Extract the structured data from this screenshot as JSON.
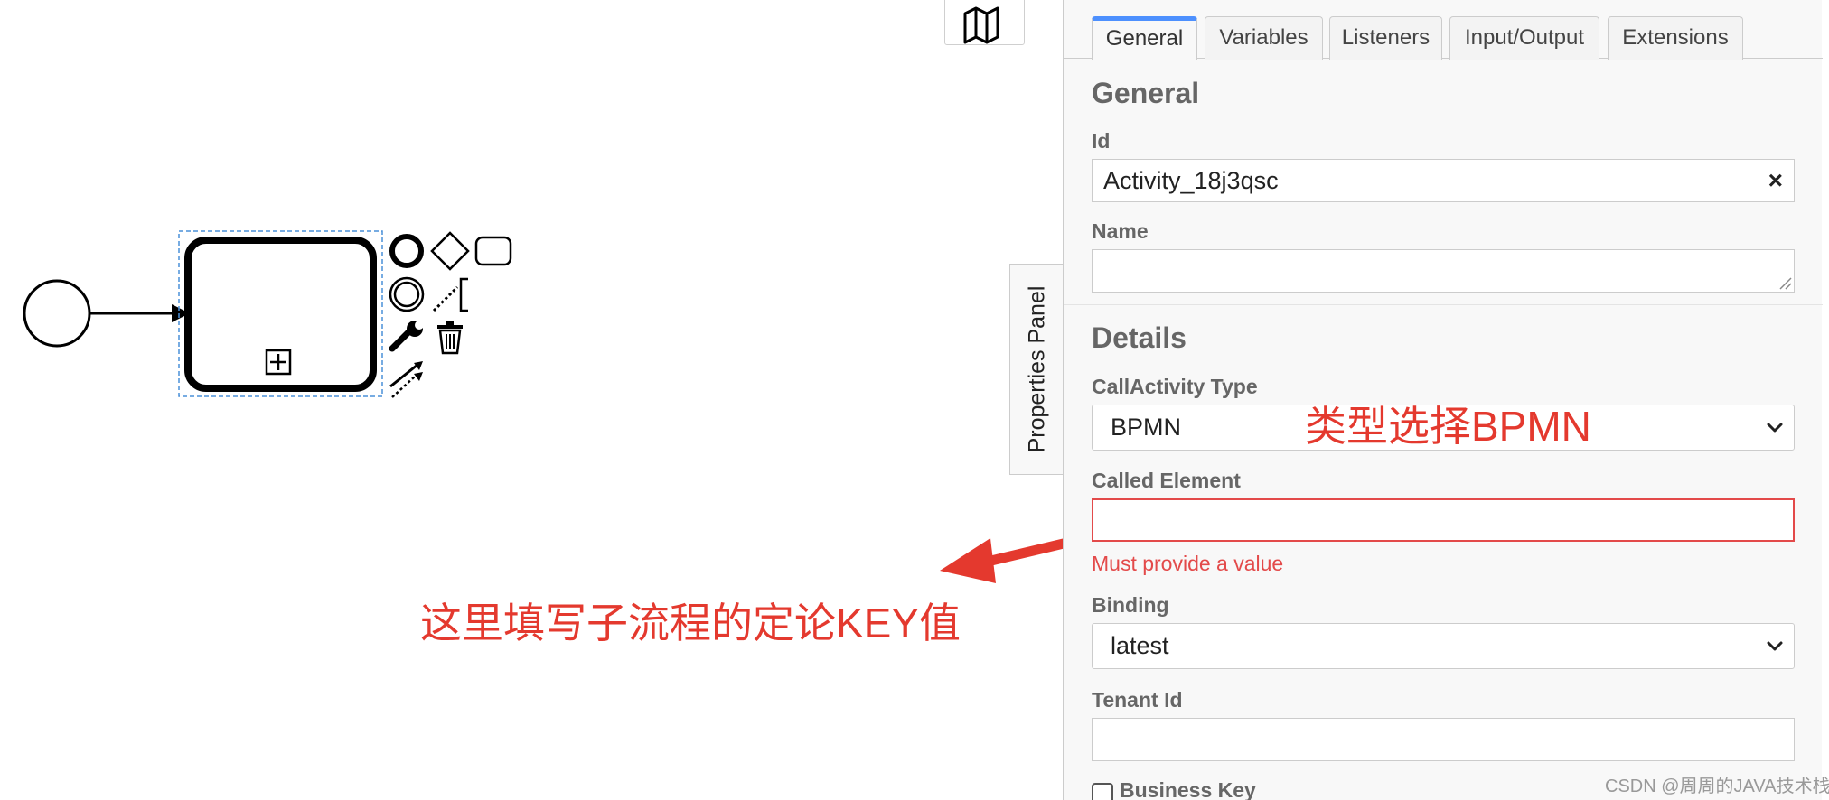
{
  "panel_toggle": {
    "label": "Properties Panel"
  },
  "tabs": [
    {
      "label": "General",
      "active": true
    },
    {
      "label": "Variables",
      "active": false
    },
    {
      "label": "Listeners",
      "active": false
    },
    {
      "label": "Input/Output",
      "active": false
    },
    {
      "label": "Extensions",
      "active": false
    }
  ],
  "general_group": {
    "title": "General",
    "id_label": "Id",
    "id_value": "Activity_18j3qsc",
    "clear_symbol": "×",
    "name_label": "Name",
    "name_value": ""
  },
  "details_group": {
    "title": "Details",
    "callactivity_type_label": "CallActivity Type",
    "callactivity_type_value": "BPMN",
    "called_element_label": "Called Element",
    "called_element_value": "",
    "called_element_error": "Must provide a value",
    "binding_label": "Binding",
    "binding_value": "latest",
    "tenant_id_label": "Tenant Id",
    "tenant_id_value": "",
    "business_key_label": "Business Key",
    "business_key_checked": false
  },
  "annotations": {
    "type_hint": "类型选择BPMN",
    "called_element_hint": "这里填写子流程的定论KEY值"
  },
  "watermark": "CSDN @周周的JAVA技术栈",
  "colors": {
    "annotation": "#e4392e",
    "error": "#e34a4a",
    "active_tab": "#4d90fe",
    "selection": "#4a90d9"
  },
  "icons": {
    "map": "map-icon",
    "expand": "plus-square-icon",
    "context_pad": [
      "end-event-icon",
      "gateway-icon",
      "task-icon",
      "intermediate-event-icon",
      "text-annotation-icon",
      "wrench-icon",
      "trash-icon",
      "connect-arrow-icon"
    ]
  }
}
